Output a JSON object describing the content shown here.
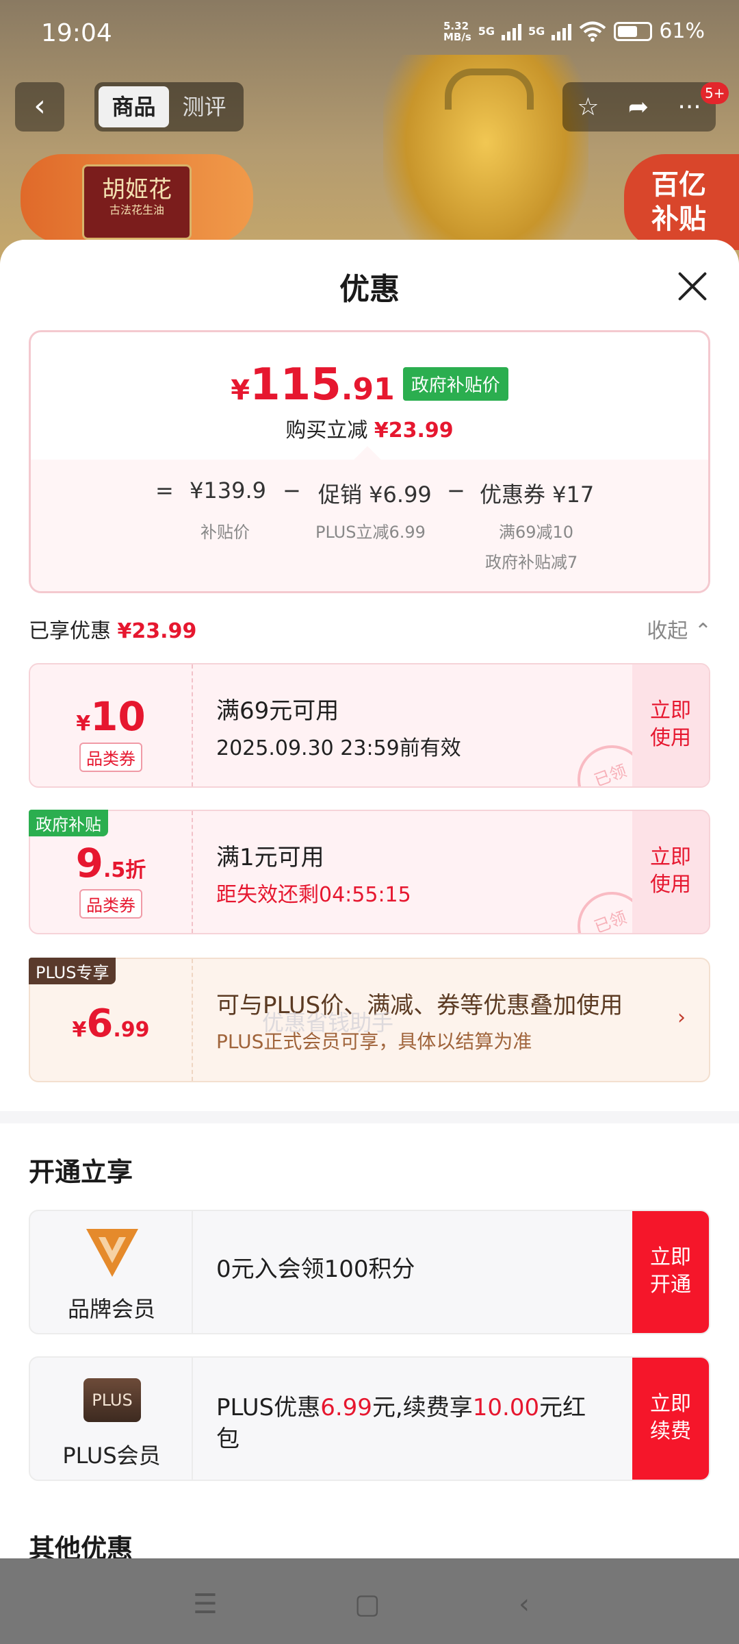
{
  "status_bar": {
    "time": "19:04",
    "speed_top": "5.32",
    "speed_bottom": "MB/s",
    "net1": "5G",
    "net2": "5G",
    "battery": "61%"
  },
  "nav": {
    "tabs": [
      "商品",
      "测评"
    ],
    "badge": "5+"
  },
  "background": {
    "brand_top": "胡姬花",
    "brand_sub": "古法花生油",
    "subsidy_badge_line1": "百亿",
    "subsidy_badge_line2": "补贴"
  },
  "sheet": {
    "title": "优惠"
  },
  "price_card": {
    "price_yen": "¥",
    "price_int": "115",
    "price_dec": ".91",
    "price_tag": "政府补贴价",
    "reduce_label": "购买立减",
    "reduce_value": "¥23.99",
    "breakdown": {
      "eq": "=",
      "minus": "−",
      "base_value": "¥139.9",
      "base_label": "补贴价",
      "promo_value": "促销 ¥6.99",
      "promo_label": "PLUS立减6.99",
      "coupon_value": "优惠券 ¥17",
      "coupon_label_1": "满69减10",
      "coupon_label_2": "政府补贴减7"
    }
  },
  "enjoyed": {
    "label": "已享优惠",
    "value": "¥23.99",
    "collapse": "收起"
  },
  "coupons": [
    {
      "yen": "¥",
      "big": "10",
      "small": "",
      "category": "品类券",
      "line1": "满69元可用",
      "line2": "2025.09.30 23:59前有效",
      "action1": "立即",
      "action2": "使用",
      "stamp": "已领"
    },
    {
      "ribbon": "政府补贴",
      "yen": "",
      "big": "9",
      "small": ".5折",
      "category": "品类券",
      "line1": "满1元可用",
      "line2": "距失效还剩04:55:15",
      "action1": "立即",
      "action2": "使用",
      "stamp": "已领"
    }
  ],
  "plus_offer": {
    "ribbon": "PLUS专享",
    "yen": "¥",
    "big": "6",
    "small": ".99",
    "line1": "可与PLUS价、满减、券等优惠叠加使用",
    "line2": "PLUS正式会员可享，具体以结算为准",
    "arrow": "›"
  },
  "watermark": "优惠省钱助手",
  "membership": {
    "title": "开通立享",
    "brand": {
      "label": "品牌会员",
      "text": "0元入会领100积分",
      "btn1": "立即",
      "btn2": "开通"
    },
    "plus": {
      "logo": "PLUS",
      "label": "PLUS会员",
      "text_a": "PLUS优惠",
      "text_b": "6.99",
      "text_c": "元,续费享",
      "text_d": "10.00",
      "text_e": "元红包",
      "btn1": "立即",
      "btn2": "续费"
    }
  },
  "other_title": "其他优惠",
  "colors": {
    "accent_red": "#e6172f",
    "green_tag": "#2bae4f",
    "cta_red": "#f5162a"
  }
}
